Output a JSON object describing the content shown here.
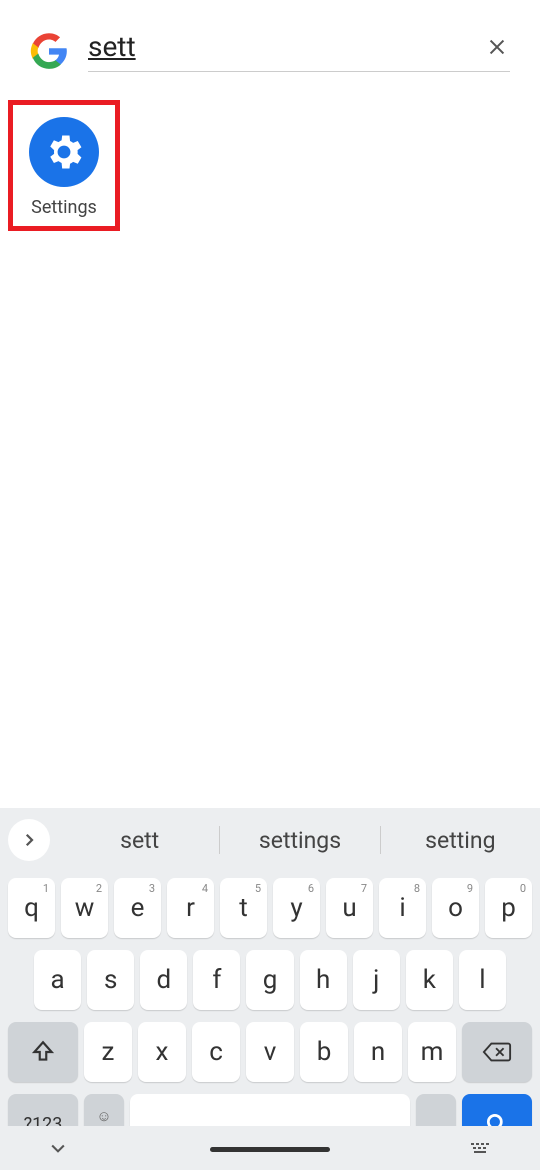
{
  "search": {
    "query": "sett"
  },
  "results": [
    {
      "label": "Settings",
      "icon": "gear"
    }
  ],
  "suggestions": [
    "sett",
    "settings",
    "setting"
  ],
  "keyboard": {
    "row1": [
      {
        "k": "q",
        "n": "1"
      },
      {
        "k": "w",
        "n": "2"
      },
      {
        "k": "e",
        "n": "3"
      },
      {
        "k": "r",
        "n": "4"
      },
      {
        "k": "t",
        "n": "5"
      },
      {
        "k": "y",
        "n": "6"
      },
      {
        "k": "u",
        "n": "7"
      },
      {
        "k": "i",
        "n": "8"
      },
      {
        "k": "o",
        "n": "9"
      },
      {
        "k": "p",
        "n": "0"
      }
    ],
    "row2": [
      "a",
      "s",
      "d",
      "f",
      "g",
      "h",
      "j",
      "k",
      "l"
    ],
    "row3": [
      "z",
      "x",
      "c",
      "v",
      "b",
      "n",
      "m"
    ],
    "symbols_label": "?123",
    "comma": ",",
    "period": "."
  }
}
